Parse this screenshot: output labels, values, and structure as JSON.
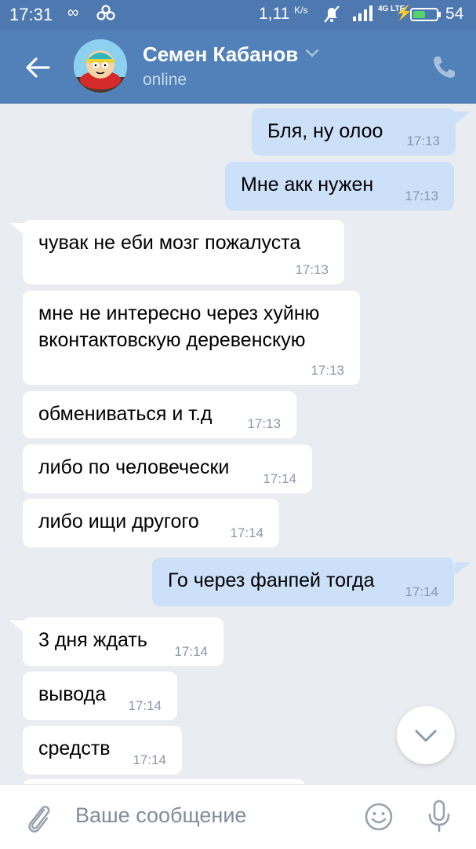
{
  "status_bar": {
    "time": "17:31",
    "speed": "1,11",
    "speed_unit": "K/s",
    "network": "4G LTE",
    "battery": "54",
    "battery_level": 0.54,
    "battery_color": "#55d36a"
  },
  "header": {
    "contact_name": "Семен Кабанов",
    "contact_status": "online",
    "bg_color": "#5181b8"
  },
  "messages": [
    {
      "dir": "out",
      "text": "Бля, ну олоо",
      "time": "17:13"
    },
    {
      "dir": "out",
      "text": "Мне акк нужен",
      "time": "17:13"
    },
    {
      "dir": "in",
      "text": "чувак не еби мозг пожалуста",
      "time": "17:13"
    },
    {
      "dir": "in",
      "text": "мне не интересно через хуйню вконтактовскую деревенскую",
      "time": "17:13"
    },
    {
      "dir": "in",
      "text": "обмениваться и т.д",
      "time": "17:13"
    },
    {
      "dir": "in",
      "text": "либо по человечески",
      "time": "17:14"
    },
    {
      "dir": "in",
      "text": "либо ищи другого",
      "time": "17:14"
    },
    {
      "dir": "out",
      "text": "Го через фанпей тогда",
      "time": "17:14"
    },
    {
      "dir": "in",
      "text": "3 дня ждать",
      "time": "17:14"
    },
    {
      "dir": "in",
      "text": "вывода",
      "time": "17:14"
    },
    {
      "dir": "in",
      "text": "средств",
      "time": "17:14"
    }
  ],
  "composer": {
    "placeholder": "Ваше сообщение"
  },
  "icons": {
    "back": "arrow-left-icon",
    "call": "phone-icon",
    "attach": "paperclip-icon",
    "emoji": "smiley-icon",
    "mic": "microphone-icon",
    "scroll_down": "chevron-down-icon"
  }
}
